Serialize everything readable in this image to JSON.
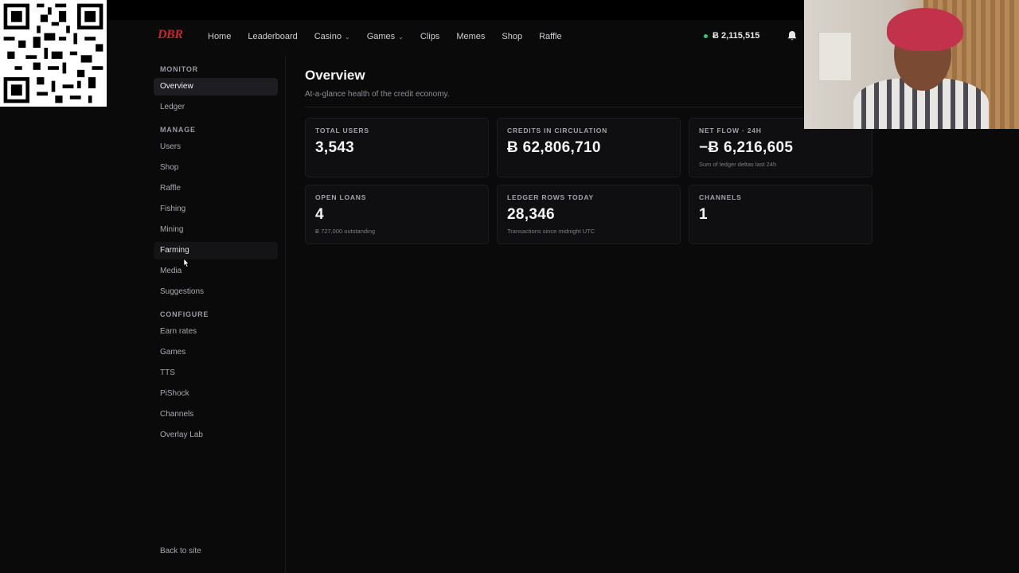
{
  "header": {
    "logo": "DBR",
    "nav": [
      {
        "label": "Home",
        "dropdown": false
      },
      {
        "label": "Leaderboard",
        "dropdown": false
      },
      {
        "label": "Casino",
        "dropdown": true
      },
      {
        "label": "Games",
        "dropdown": true
      },
      {
        "label": "Clips",
        "dropdown": false
      },
      {
        "label": "Memes",
        "dropdown": false
      },
      {
        "label": "Shop",
        "dropdown": false
      },
      {
        "label": "Raffle",
        "dropdown": false
      }
    ],
    "balance": "Ƀ 2,115,515",
    "status_color": "#2ecc71"
  },
  "sidebar": {
    "sections": [
      {
        "title": "MONITOR",
        "items": [
          "Overview",
          "Ledger"
        ]
      },
      {
        "title": "MANAGE",
        "items": [
          "Users",
          "Shop",
          "Raffle",
          "Fishing",
          "Mining",
          "Farming",
          "Media",
          "Suggestions"
        ]
      },
      {
        "title": "CONFIGURE",
        "items": [
          "Earn rates",
          "Games",
          "TTS",
          "PiShock",
          "Channels",
          "Overlay Lab"
        ]
      }
    ],
    "active_item": "Overview",
    "hover_item": "Farming",
    "back_link": "Back to site"
  },
  "main": {
    "title": "Overview",
    "subtitle": "At-a-glance health of the credit economy.",
    "cards": [
      {
        "label": "TOTAL USERS",
        "value": "3,543",
        "sub": ""
      },
      {
        "label": "CREDITS IN CIRCULATION",
        "value": "Ƀ 62,806,710",
        "sub": ""
      },
      {
        "label": "NET FLOW · 24H",
        "value": "−Ƀ 6,216,605",
        "sub": "Sum of ledger deltas last 24h"
      },
      {
        "label": "OPEN LOANS",
        "value": "4",
        "sub": "Ƀ 727,000 outstanding"
      },
      {
        "label": "LEDGER ROWS TODAY",
        "value": "28,346",
        "sub": "Transactions since midnight UTC"
      },
      {
        "label": "CHANNELS",
        "value": "1",
        "sub": ""
      }
    ]
  },
  "colors": {
    "background": "#0a0a0b",
    "brand": "#c62828",
    "card": "#0f0f11"
  }
}
